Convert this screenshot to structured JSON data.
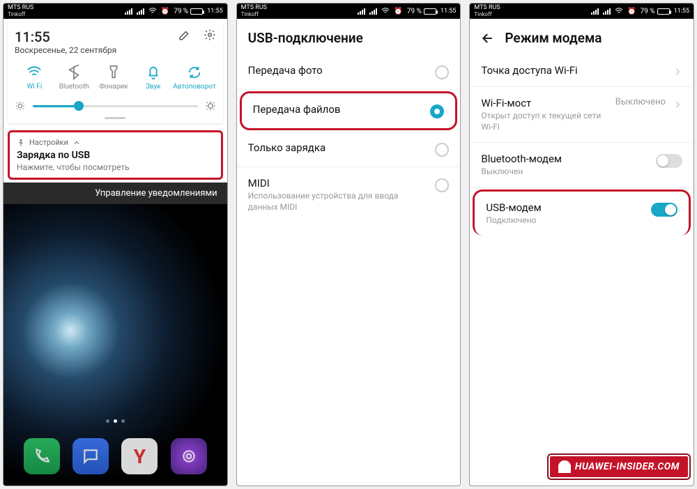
{
  "statusbar": {
    "carrier1": "MTS RUS",
    "carrier2": "Tinkoff",
    "battery_pct": "79 %",
    "time": "11:55"
  },
  "screen1": {
    "clock_time": "11:55",
    "clock_date": "Воскресенье, 22 сентября",
    "qs": {
      "wifi": "Wi Fi",
      "bluetooth": "Bluetooth",
      "flashlight": "Фонарик",
      "sound": "Звук",
      "autorotate": "Автоповорот"
    },
    "notif": {
      "app": "Настройки",
      "title": "Зарядка по USB",
      "sub": "Нажмите, чтобы посмотреть"
    },
    "manage": "Управление уведомлениями"
  },
  "screen2": {
    "title": "USB-подключение",
    "items": {
      "photo": "Передача фото",
      "files": "Передача файлов",
      "charge": "Только зарядка",
      "midi": "MIDI",
      "midi_sub": "Использование устройства для ввода данных MIDI"
    }
  },
  "screen3": {
    "title": "Режим модема",
    "items": {
      "hotspot": "Точка доступа Wi-Fi",
      "bridge": "Wi-Fi-мост",
      "bridge_sub": "Открыт доступ к текущей сети Wi-Fi",
      "bridge_val": "Выключено",
      "bt": "Bluetooth-модем",
      "bt_sub": "Выключен",
      "usb": "USB-модем",
      "usb_sub": "Подключено"
    }
  },
  "watermark": "HUAWEI-INSIDER.COM"
}
